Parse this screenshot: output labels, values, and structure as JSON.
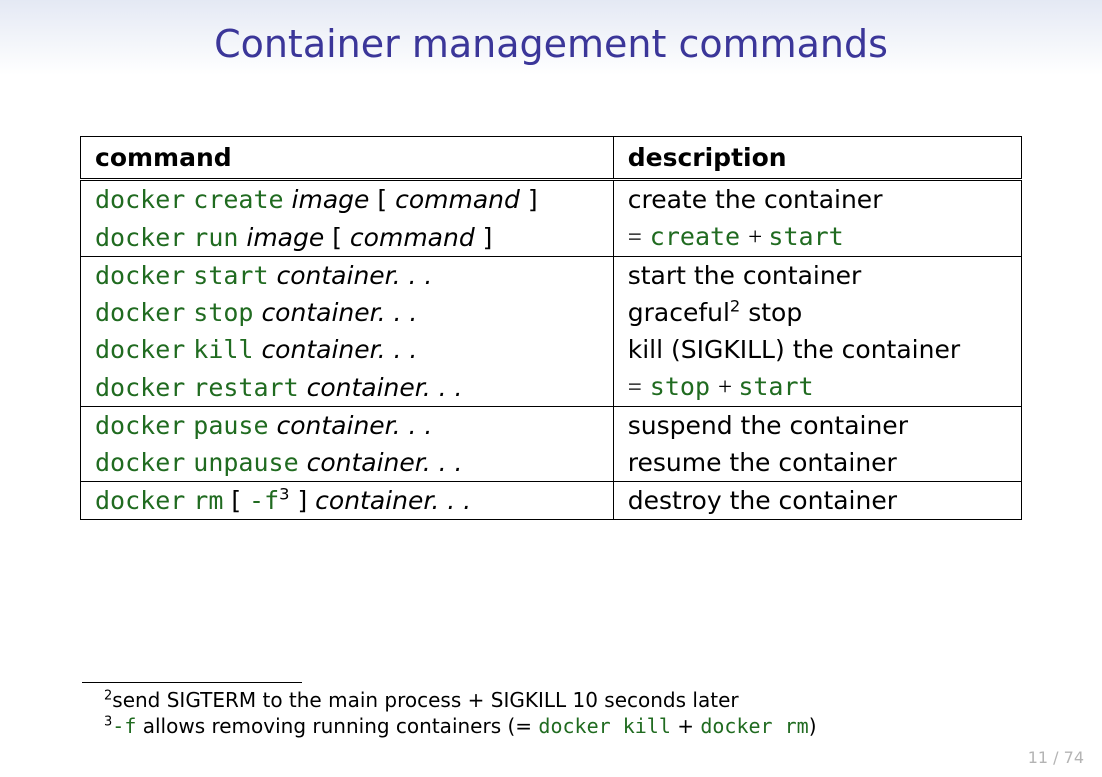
{
  "title": "Container management commands",
  "headers": {
    "col1": "command",
    "col2": "description"
  },
  "rows": [
    {
      "docker": "docker",
      "cmd": "create",
      "arg": "image",
      "opt": "command",
      "desc_plain": "create the container"
    },
    {
      "docker": "docker",
      "cmd": "run",
      "arg": "image",
      "opt": "command",
      "desc_eq_a": "create",
      "desc_eq_b": "start"
    },
    {
      "docker": "docker",
      "cmd": "start",
      "arg": "container. . .",
      "desc_plain": "start the container"
    },
    {
      "docker": "docker",
      "cmd": "stop",
      "arg": "container. . .",
      "desc_graceful": "graceful",
      "desc_graceful_fn": "2",
      "desc_graceful_tail": " stop"
    },
    {
      "docker": "docker",
      "cmd": "kill",
      "arg": "container. . .",
      "desc_plain": "kill (SIGKILL) the container"
    },
    {
      "docker": "docker",
      "cmd": "restart",
      "arg": "container. . .",
      "desc_eq_a": "stop",
      "desc_eq_b": "start"
    },
    {
      "docker": "docker",
      "cmd": "pause",
      "arg": "container. . .",
      "desc_plain": "suspend the container"
    },
    {
      "docker": "docker",
      "cmd": "unpause",
      "arg": "container. . .",
      "desc_plain": "resume the container"
    },
    {
      "docker": "docker",
      "cmd": "rm",
      "flag": "-f",
      "flag_fn": "3",
      "arg_after": "container. . .",
      "desc_plain": "destroy the container"
    }
  ],
  "footnotes": {
    "fn2_num": "2",
    "fn2_text": "send SIGTERM to the main process + SIGKILL 10 seconds later",
    "fn3_num": "3",
    "fn3_flag": "-f",
    "fn3_mid": " allows removing running containers (= ",
    "fn3_code_a": "docker kill",
    "fn3_plus": " + ",
    "fn3_code_b": "docker rm",
    "fn3_end": ")"
  },
  "page": "11 / 74",
  "glyphs": {
    "lbrack": "[",
    "rbrack": "]",
    "eq": "=",
    "plus": "+"
  }
}
